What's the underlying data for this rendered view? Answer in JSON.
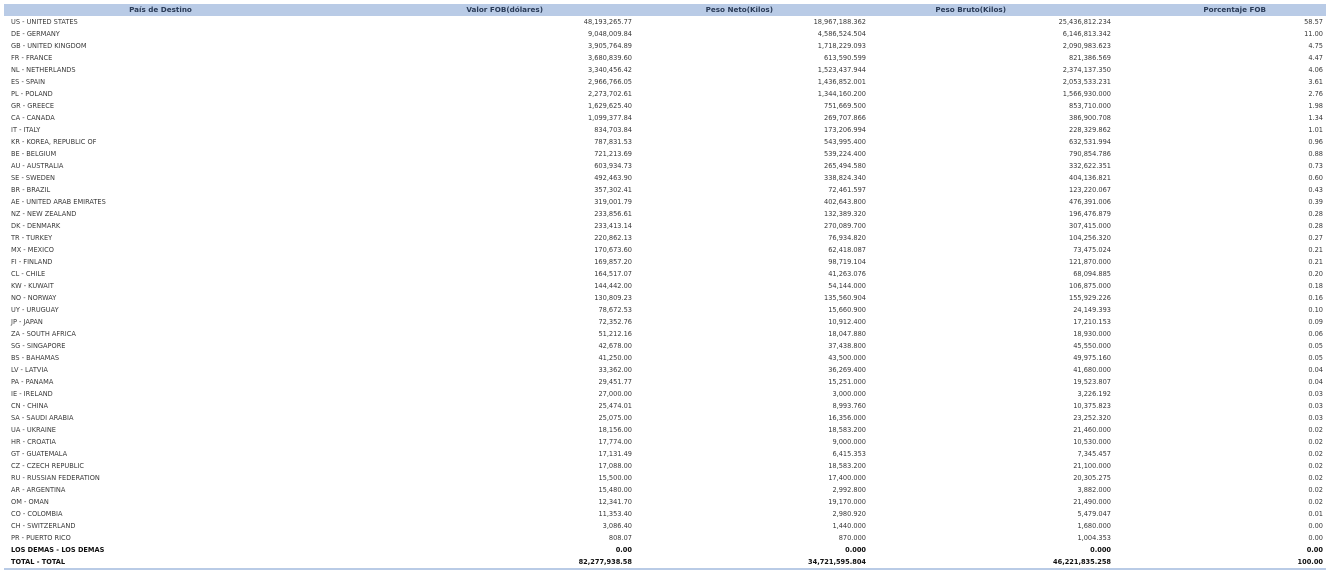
{
  "table": {
    "headers": [
      "País de Destino",
      "Valor FOB(dólares)",
      "Peso Neto(Kilos)",
      "Peso Bruto(Kilos)",
      "Porcentaje FOB"
    ],
    "rows": [
      [
        "US - UNITED STATES",
        "48,193,265.77",
        "18,967,188.362",
        "25,436,812.234",
        "58.57"
      ],
      [
        "DE - GERMANY",
        "9,048,009.84",
        "4,586,524.504",
        "6,146,813.342",
        "11.00"
      ],
      [
        "GB - UNITED KINGDOM",
        "3,905,764.89",
        "1,718,229.093",
        "2,090,983.623",
        "4.75"
      ],
      [
        "FR - FRANCE",
        "3,680,839.60",
        "613,590.599",
        "821,386.569",
        "4.47"
      ],
      [
        "NL - NETHERLANDS",
        "3,340,456.42",
        "1,523,437.944",
        "2,374,137.350",
        "4.06"
      ],
      [
        "ES - SPAIN",
        "2,966,766.05",
        "1,436,852.001",
        "2,053,533.231",
        "3.61"
      ],
      [
        "PL - POLAND",
        "2,273,702.61",
        "1,344,160.200",
        "1,566,930.000",
        "2.76"
      ],
      [
        "GR - GREECE",
        "1,629,625.40",
        "751,669.500",
        "853,710.000",
        "1.98"
      ],
      [
        "CA - CANADA",
        "1,099,377.84",
        "269,707.866",
        "386,900.708",
        "1.34"
      ],
      [
        "IT - ITALY",
        "834,703.84",
        "173,206.994",
        "228,329.862",
        "1.01"
      ],
      [
        "KR - KOREA, REPUBLIC OF",
        "787,831.53",
        "543,995.400",
        "632,531.994",
        "0.96"
      ],
      [
        "BE - BELGIUM",
        "721,213.69",
        "539,224.400",
        "790,854.786",
        "0.88"
      ],
      [
        "AU - AUSTRALIA",
        "603,934.73",
        "265,494.580",
        "332,622.351",
        "0.73"
      ],
      [
        "SE - SWEDEN",
        "492,463.90",
        "338,824.340",
        "404,136.821",
        "0.60"
      ],
      [
        "BR - BRAZIL",
        "357,302.41",
        "72,461.597",
        "123,220.067",
        "0.43"
      ],
      [
        "AE - UNITED ARAB EMIRATES",
        "319,001.79",
        "402,643.800",
        "476,391.006",
        "0.39"
      ],
      [
        "NZ - NEW ZEALAND",
        "233,856.61",
        "132,389.320",
        "196,476.879",
        "0.28"
      ],
      [
        "DK - DENMARK",
        "233,413.14",
        "270,089.700",
        "307,415.000",
        "0.28"
      ],
      [
        "TR - TURKEY",
        "220,862.13",
        "76,934.820",
        "104,256.320",
        "0.27"
      ],
      [
        "MX - MEXICO",
        "170,673.60",
        "62,418.087",
        "73,475.024",
        "0.21"
      ],
      [
        "FI - FINLAND",
        "169,857.20",
        "98,719.104",
        "121,870.000",
        "0.21"
      ],
      [
        "CL - CHILE",
        "164,517.07",
        "41,263.076",
        "68,094.885",
        "0.20"
      ],
      [
        "KW - KUWAIT",
        "144,442.00",
        "54,144.000",
        "106,875.000",
        "0.18"
      ],
      [
        "NO - NORWAY",
        "130,809.23",
        "135,560.904",
        "155,929.226",
        "0.16"
      ],
      [
        "UY - URUGUAY",
        "78,672.53",
        "15,660.900",
        "24,149.393",
        "0.10"
      ],
      [
        "JP - JAPAN",
        "72,352.76",
        "10,912.400",
        "17,210.153",
        "0.09"
      ],
      [
        "ZA - SOUTH AFRICA",
        "51,212.16",
        "18,047.880",
        "18,930.000",
        "0.06"
      ],
      [
        "SG - SINGAPORE",
        "42,678.00",
        "37,438.800",
        "45,550.000",
        "0.05"
      ],
      [
        "BS - BAHAMAS",
        "41,250.00",
        "43,500.000",
        "49,975.160",
        "0.05"
      ],
      [
        "LV - LATVIA",
        "33,362.00",
        "36,269.400",
        "41,680.000",
        "0.04"
      ],
      [
        "PA - PANAMA",
        "29,451.77",
        "15,251.000",
        "19,523.807",
        "0.04"
      ],
      [
        "IE - IRELAND",
        "27,000.00",
        "3,000.000",
        "3,226.192",
        "0.03"
      ],
      [
        "CN - CHINA",
        "25,474.01",
        "8,993.760",
        "10,375.823",
        "0.03"
      ],
      [
        "SA - SAUDI ARABIA",
        "25,075.00",
        "16,356.000",
        "23,252.320",
        "0.03"
      ],
      [
        "UA - UKRAINE",
        "18,156.00",
        "18,583.200",
        "21,460.000",
        "0.02"
      ],
      [
        "HR - CROATIA",
        "17,774.00",
        "9,000.000",
        "10,530.000",
        "0.02"
      ],
      [
        "GT - GUATEMALA",
        "17,131.49",
        "6,415.353",
        "7,345.457",
        "0.02"
      ],
      [
        "CZ - CZECH REPUBLIC",
        "17,088.00",
        "18,583.200",
        "21,100.000",
        "0.02"
      ],
      [
        "RU - RUSSIAN FEDERATION",
        "15,500.00",
        "17,400.000",
        "20,305.275",
        "0.02"
      ],
      [
        "AR - ARGENTINA",
        "15,480.00",
        "2,992.800",
        "3,882.000",
        "0.02"
      ],
      [
        "OM - OMAN",
        "12,341.70",
        "19,170.000",
        "21,490.000",
        "0.02"
      ],
      [
        "CO - COLOMBIA",
        "11,353.40",
        "2,980.920",
        "5,479.047",
        "0.01"
      ],
      [
        "CH - SWITZERLAND",
        "3,086.40",
        "1,440.000",
        "1,680.000",
        "0.00"
      ],
      [
        "PR - PUERTO RICO",
        "808.07",
        "870.000",
        "1,004.353",
        "0.00"
      ]
    ],
    "others_row": [
      "LOS DEMAS - LOS DEMAS",
      "0.00",
      "0.000",
      "0.000",
      "0.00"
    ],
    "total_row": [
      "TOTAL - TOTAL",
      "82,277,938.58",
      "34,721,595.804",
      "46,221,835.258",
      "100.00"
    ]
  },
  "colors": {
    "header_bg": "#b9cbe6",
    "header_text": "#2a3b57",
    "body_text": "#3a3a3a"
  }
}
